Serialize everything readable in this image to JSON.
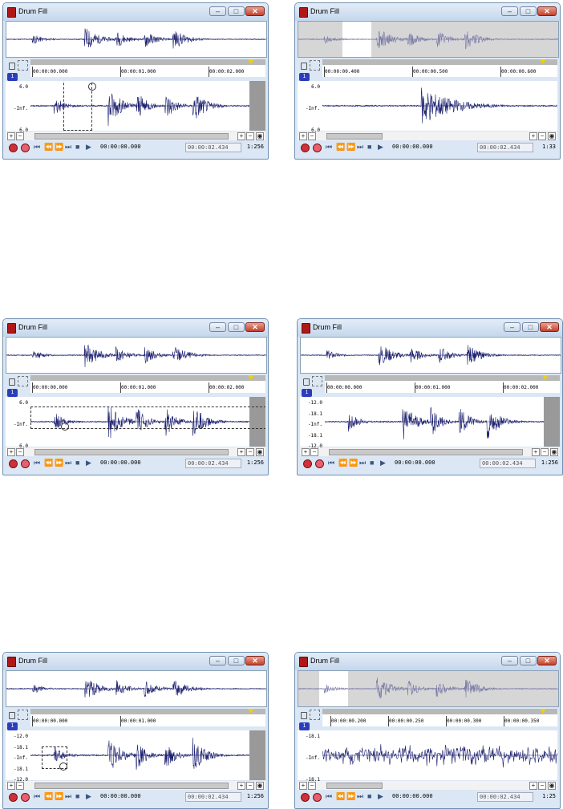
{
  "windows": [
    {
      "title": "Drum Fill",
      "overview_selection": null,
      "ruler_ticks": [
        "00:00:00.000",
        "00:00:01.000",
        "00:00:02.000"
      ],
      "db_labels": [
        "6.0",
        "-Inf.",
        "6.0"
      ],
      "transport": {
        "position": "00:00:00.000",
        "length": "00:00:02.434",
        "zoom": "1:256"
      },
      "variant": "full"
    },
    {
      "title": "Drum Fill",
      "overview_selection": "0.17-0.28",
      "ruler_ticks": [
        "00:00:00.400",
        "00:00:00.500",
        "00:00:00.600"
      ],
      "db_labels": [
        "6.0",
        "-Inf.",
        "6.0"
      ],
      "transport": {
        "position": "00:00:00.000",
        "length": "00:00:02.434",
        "zoom": "1:33"
      },
      "variant": "zoomed"
    },
    {
      "title": "Drum Fill",
      "overview_selection": null,
      "ruler_ticks": [
        "00:00:00.000",
        "00:00:01.000",
        "00:00:02.000"
      ],
      "db_labels": [
        "6.0",
        "-Inf.",
        "6.0"
      ],
      "transport": {
        "position": "00:00:00.000",
        "length": "00:00:02.434",
        "zoom": "1:256"
      },
      "variant": "full-dbsel"
    },
    {
      "title": "Drum Fill",
      "overview_selection": null,
      "ruler_ticks": [
        "00:00:00.000",
        "00:00:01.000",
        "00:00:02.000"
      ],
      "db_labels": [
        "-12.0",
        "-18.1",
        "-Inf.",
        "-18.1",
        "-12.0"
      ],
      "transport": {
        "position": "00:00:00.000",
        "length": "00:00:02.434",
        "zoom": "1:256"
      },
      "variant": "full-tall"
    },
    {
      "title": "Drum Fill",
      "overview_selection": null,
      "ruler_ticks": [
        "00:00:00.000",
        "00:00:01.000"
      ],
      "db_labels": [
        "-12.0",
        "-18.1",
        "-Inf.",
        "-18.1",
        "-12.0"
      ],
      "transport": {
        "position": "00:00:00.000",
        "length": "00:00:02.434",
        "zoom": "1:256"
      },
      "variant": "full-tall-zoomrect"
    },
    {
      "title": "Drum Fill",
      "overview_selection": "0.08-0.19",
      "ruler_ticks": [
        "00:00:00.200",
        "00:00:00.250",
        "00:00:00.300",
        "00:00:00.350"
      ],
      "db_labels": [
        "-18.1",
        "-Inf.",
        "-18.1"
      ],
      "transport": {
        "position": "00:00:00.000",
        "length": "00:00:02.434",
        "zoom": "1:25"
      },
      "variant": "zoomed-dense"
    }
  ]
}
